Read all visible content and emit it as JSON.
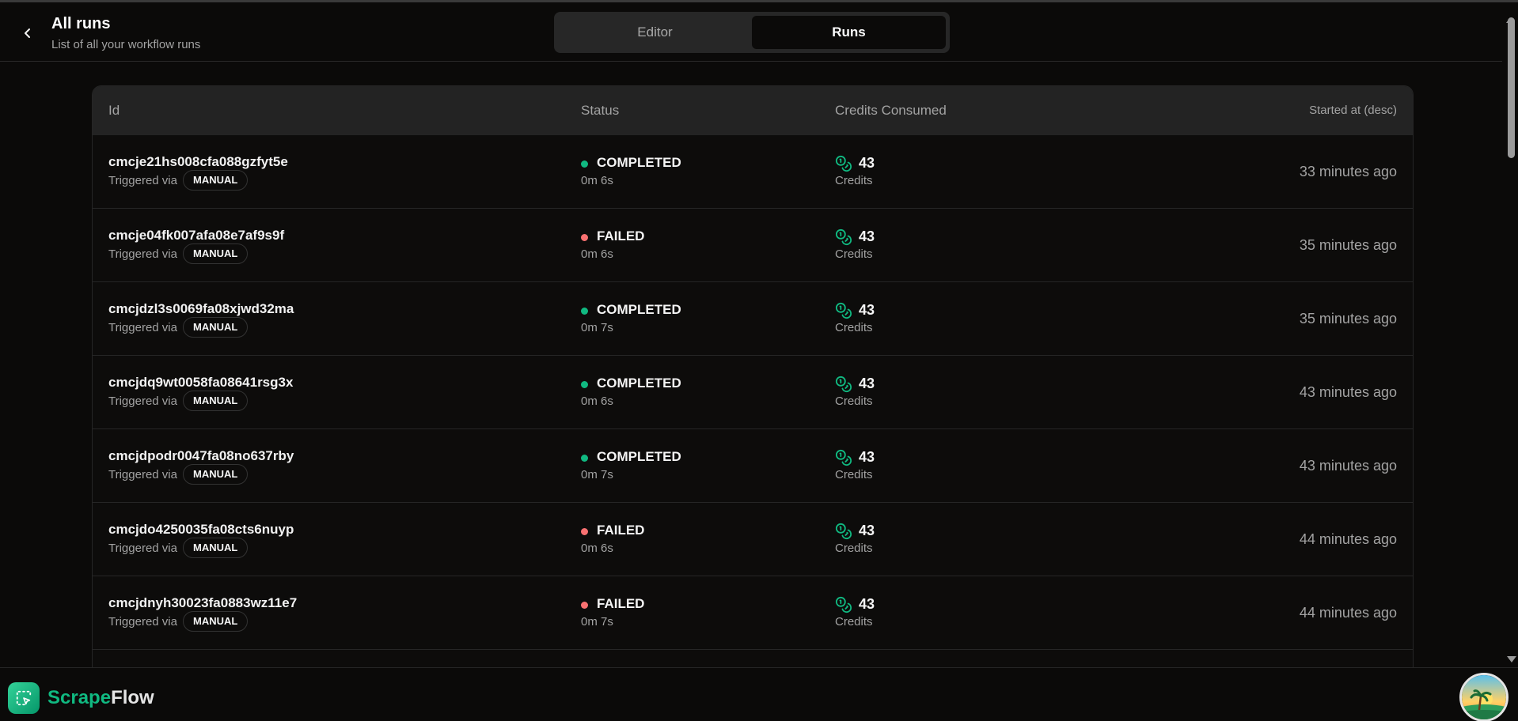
{
  "header": {
    "title": "All runs",
    "subtitle": "List of all your workflow runs"
  },
  "tabs": [
    {
      "label": "Editor",
      "active": false
    },
    {
      "label": "Runs",
      "active": true
    }
  ],
  "table": {
    "columns": {
      "id": "Id",
      "status": "Status",
      "credits": "Credits Consumed",
      "started": "Started at (desc)"
    },
    "rows": [
      {
        "id": "cmcje21hs008cfa088gzfyt5e",
        "trigger_label": "Triggered via",
        "trigger": "MANUAL",
        "status": "COMPLETED",
        "duration": "0m 6s",
        "credits": "43",
        "credits_label": "Credits",
        "started": "33 minutes ago"
      },
      {
        "id": "cmcje04fk007afa08e7af9s9f",
        "trigger_label": "Triggered via",
        "trigger": "MANUAL",
        "status": "FAILED",
        "duration": "0m 6s",
        "credits": "43",
        "credits_label": "Credits",
        "started": "35 minutes ago"
      },
      {
        "id": "cmcjdzl3s0069fa08xjwd32ma",
        "trigger_label": "Triggered via",
        "trigger": "MANUAL",
        "status": "COMPLETED",
        "duration": "0m 7s",
        "credits": "43",
        "credits_label": "Credits",
        "started": "35 minutes ago"
      },
      {
        "id": "cmcjdq9wt0058fa08641rsg3x",
        "trigger_label": "Triggered via",
        "trigger": "MANUAL",
        "status": "COMPLETED",
        "duration": "0m 6s",
        "credits": "43",
        "credits_label": "Credits",
        "started": "43 minutes ago"
      },
      {
        "id": "cmcjdpodr0047fa08no637rby",
        "trigger_label": "Triggered via",
        "trigger": "MANUAL",
        "status": "COMPLETED",
        "duration": "0m 7s",
        "credits": "43",
        "credits_label": "Credits",
        "started": "43 minutes ago"
      },
      {
        "id": "cmcjdo4250035fa08cts6nuyp",
        "trigger_label": "Triggered via",
        "trigger": "MANUAL",
        "status": "FAILED",
        "duration": "0m 6s",
        "credits": "43",
        "credits_label": "Credits",
        "started": "44 minutes ago"
      },
      {
        "id": "cmcjdnyh30023fa0883wz11e7",
        "trigger_label": "Triggered via",
        "trigger": "MANUAL",
        "status": "FAILED",
        "duration": "0m 7s",
        "credits": "43",
        "credits_label": "Credits",
        "started": "44 minutes ago"
      }
    ]
  },
  "status_colors": {
    "COMPLETED": "#10b981",
    "FAILED": "#f87171"
  },
  "brand": {
    "name_part1": "Scrape",
    "name_part2": "Flow",
    "accent": "#10b981"
  },
  "icons": {
    "back": "chevron-left-icon",
    "credits": "coins-icon",
    "logo": "square-dashed-mouse-pointer-icon",
    "avatar": "user-avatar"
  }
}
